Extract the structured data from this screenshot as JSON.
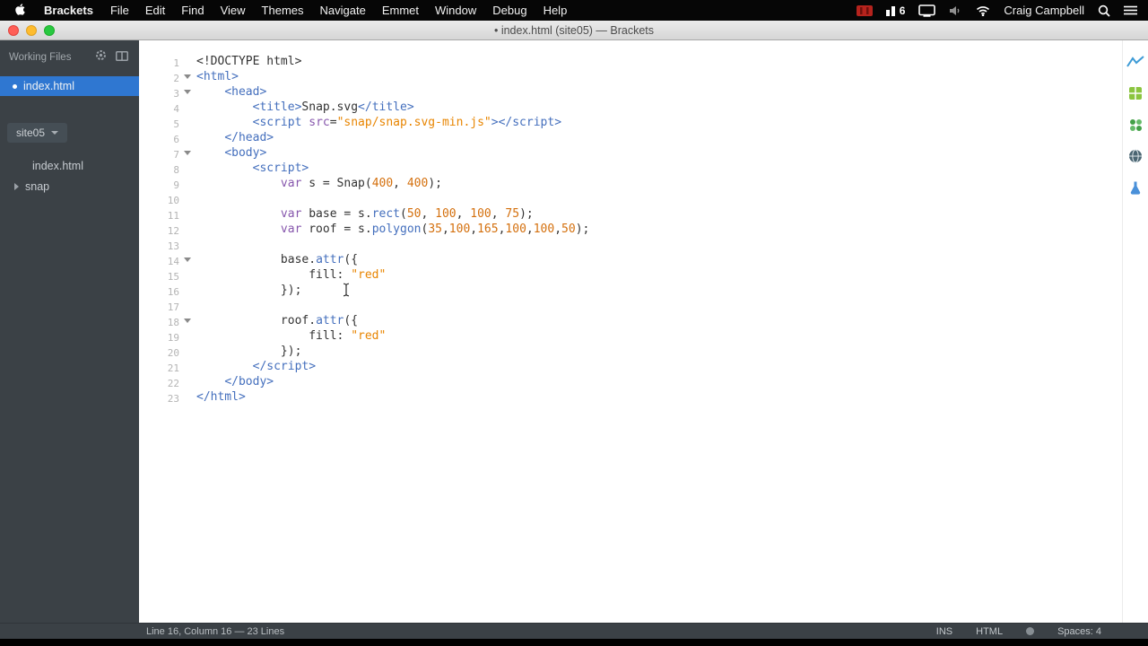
{
  "theme": {
    "selection_blue": "#2f77d1",
    "menubar_bg": "#060606",
    "sidebar_bg": "#3b4146",
    "statusbar_bg": "#3b4146",
    "syntax": {
      "tag": "#446fbd",
      "attribute": "#8757ad",
      "keyword": "#8757ad",
      "property": "#446fbd",
      "string": "#e88501",
      "number": "#d4700e",
      "plain": "#333333"
    }
  },
  "menubar": {
    "app": "Brackets",
    "menus": [
      "File",
      "Edit",
      "Find",
      "View",
      "Themes",
      "Navigate",
      "Emmet",
      "Window",
      "Debug",
      "Help"
    ],
    "signal_count": "6",
    "user": "Craig Campbell",
    "icons": [
      "apple-icon",
      "film-strip-icon",
      "signal-bars-icon",
      "display-mirroring-icon",
      "volume-icon",
      "wifi-icon",
      "spotlight-search-icon",
      "notification-center-icon"
    ]
  },
  "titlebar": {
    "title": "• index.html (site05) — Brackets"
  },
  "sidebar": {
    "working_files_label": "Working Files",
    "open_file": "index.html",
    "project_name": "site05",
    "tree": {
      "file": "index.html",
      "folder": "snap"
    },
    "icons": [
      "gear-icon",
      "split-view-icon",
      "folder-disclosure-icon"
    ]
  },
  "editor": {
    "lines": [
      {
        "num": 1,
        "fold": false,
        "tokens": [
          [
            "plain",
            "<!DOCTYPE html>"
          ]
        ]
      },
      {
        "num": 2,
        "fold": true,
        "tokens": [
          [
            "tag",
            "<html>"
          ]
        ]
      },
      {
        "num": 3,
        "fold": true,
        "tokens": [
          [
            "plain",
            "    "
          ],
          [
            "tag",
            "<head>"
          ]
        ]
      },
      {
        "num": 4,
        "fold": false,
        "tokens": [
          [
            "plain",
            "        "
          ],
          [
            "tag",
            "<title>"
          ],
          [
            "plain",
            "Snap.svg"
          ],
          [
            "tag",
            "</title>"
          ]
        ]
      },
      {
        "num": 5,
        "fold": false,
        "tokens": [
          [
            "plain",
            "        "
          ],
          [
            "tag",
            "<script"
          ],
          [
            "plain",
            " "
          ],
          [
            "attribute",
            "src"
          ],
          [
            "plain",
            "="
          ],
          [
            "string",
            "\"snap/snap.svg-min.js\""
          ],
          [
            "tag",
            "></script>"
          ]
        ]
      },
      {
        "num": 6,
        "fold": false,
        "tokens": [
          [
            "plain",
            "    "
          ],
          [
            "tag",
            "</head>"
          ]
        ]
      },
      {
        "num": 7,
        "fold": true,
        "tokens": [
          [
            "plain",
            "    "
          ],
          [
            "tag",
            "<body>"
          ]
        ]
      },
      {
        "num": 8,
        "fold": false,
        "tokens": [
          [
            "plain",
            "        "
          ],
          [
            "tag",
            "<script>"
          ]
        ]
      },
      {
        "num": 9,
        "fold": false,
        "tokens": [
          [
            "plain",
            "            "
          ],
          [
            "keyword",
            "var"
          ],
          [
            "plain",
            " s = Snap("
          ],
          [
            "number",
            "400"
          ],
          [
            "plain",
            ", "
          ],
          [
            "number",
            "400"
          ],
          [
            "plain",
            ");"
          ]
        ]
      },
      {
        "num": 10,
        "fold": false,
        "tokens": []
      },
      {
        "num": 11,
        "fold": false,
        "tokens": [
          [
            "plain",
            "            "
          ],
          [
            "keyword",
            "var"
          ],
          [
            "plain",
            " base = s."
          ],
          [
            "property",
            "rect"
          ],
          [
            "plain",
            "("
          ],
          [
            "number",
            "50"
          ],
          [
            "plain",
            ", "
          ],
          [
            "number",
            "100"
          ],
          [
            "plain",
            ", "
          ],
          [
            "number",
            "100"
          ],
          [
            "plain",
            ", "
          ],
          [
            "number",
            "75"
          ],
          [
            "plain",
            ");"
          ]
        ]
      },
      {
        "num": 12,
        "fold": false,
        "tokens": [
          [
            "plain",
            "            "
          ],
          [
            "keyword",
            "var"
          ],
          [
            "plain",
            " roof = s."
          ],
          [
            "property",
            "polygon"
          ],
          [
            "plain",
            "("
          ],
          [
            "number",
            "35"
          ],
          [
            "plain",
            ","
          ],
          [
            "number",
            "100"
          ],
          [
            "plain",
            ","
          ],
          [
            "number",
            "165"
          ],
          [
            "plain",
            ","
          ],
          [
            "number",
            "100"
          ],
          [
            "plain",
            ","
          ],
          [
            "number",
            "100"
          ],
          [
            "plain",
            ","
          ],
          [
            "number",
            "50"
          ],
          [
            "plain",
            ");"
          ]
        ]
      },
      {
        "num": 13,
        "fold": false,
        "tokens": []
      },
      {
        "num": 14,
        "fold": true,
        "tokens": [
          [
            "plain",
            "            base."
          ],
          [
            "property",
            "attr"
          ],
          [
            "plain",
            "({"
          ]
        ]
      },
      {
        "num": 15,
        "fold": false,
        "tokens": [
          [
            "plain",
            "                fill: "
          ],
          [
            "string",
            "\"red\""
          ]
        ]
      },
      {
        "num": 16,
        "fold": false,
        "tokens": [
          [
            "plain",
            "            });"
          ]
        ]
      },
      {
        "num": 17,
        "fold": false,
        "tokens": []
      },
      {
        "num": 18,
        "fold": true,
        "tokens": [
          [
            "plain",
            "            roof."
          ],
          [
            "property",
            "attr"
          ],
          [
            "plain",
            "({"
          ]
        ]
      },
      {
        "num": 19,
        "fold": false,
        "tokens": [
          [
            "plain",
            "                fill: "
          ],
          [
            "string",
            "\"red\""
          ]
        ]
      },
      {
        "num": 20,
        "fold": false,
        "tokens": [
          [
            "plain",
            "            });"
          ]
        ]
      },
      {
        "num": 21,
        "fold": false,
        "tokens": [
          [
            "plain",
            "        "
          ],
          [
            "tag",
            "</script>"
          ]
        ]
      },
      {
        "num": 22,
        "fold": false,
        "tokens": [
          [
            "plain",
            "    "
          ],
          [
            "tag",
            "</body>"
          ]
        ]
      },
      {
        "num": 23,
        "fold": false,
        "tokens": [
          [
            "tag",
            "</html>"
          ]
        ]
      }
    ]
  },
  "rail": {
    "icons": [
      "line-chart-icon",
      "extensions-grid-icon",
      "dots-icon",
      "globe-icon",
      "beaker-icon"
    ]
  },
  "statusbar": {
    "position": "Line 16, Column 16 — 23 Lines",
    "overwrite_mode": "INS",
    "language": "HTML",
    "indent": "Spaces: 4"
  }
}
